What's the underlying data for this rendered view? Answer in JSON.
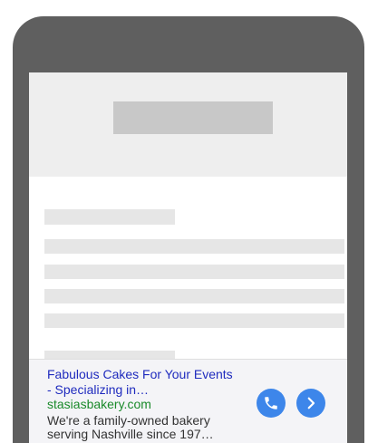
{
  "ad": {
    "title": "Fabulous Cakes For Your Events - Specializing in…",
    "display_url": "stasiasbakery.com",
    "description": "We're a family-owned bakery serving Nashville since 197…",
    "call_icon": "phone-icon",
    "next_icon": "chevron-right-icon"
  },
  "colors": {
    "device_frame": "#5f5f5f",
    "header_background": "#eeeeee",
    "placeholder_dark": "#c8c8c8",
    "placeholder_light": "#e6e6e6",
    "ad_title": "#1f2bbe",
    "ad_url": "#1a8a2a",
    "ad_button": "#3d86ea"
  }
}
